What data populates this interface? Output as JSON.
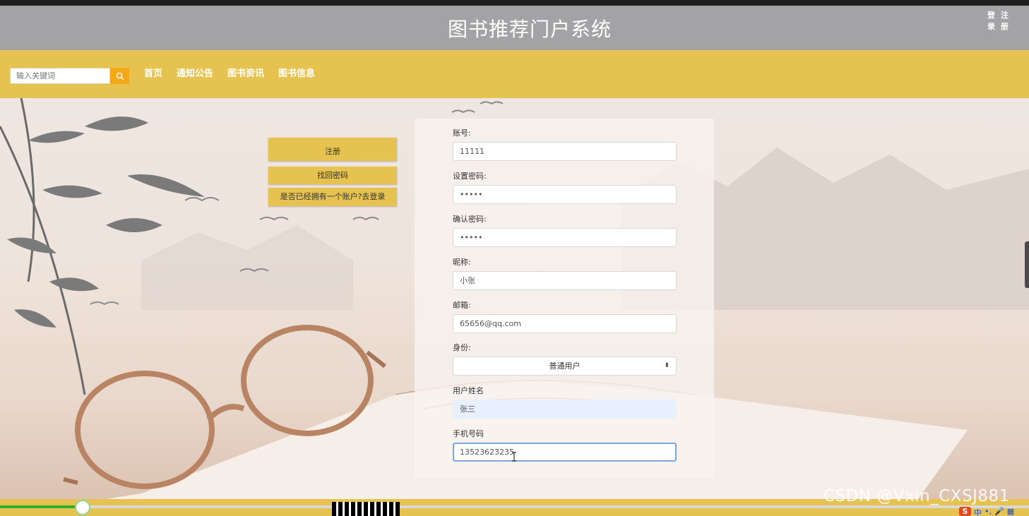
{
  "header": {
    "site_title": "图书推荐门户系统",
    "auth": {
      "login_chars": [
        "登",
        "录"
      ],
      "register_chars": [
        "注",
        "册"
      ]
    }
  },
  "search": {
    "placeholder": "输入关键词"
  },
  "nav": {
    "items": [
      "首页",
      "通知公告",
      "图书资讯",
      "图书信息"
    ]
  },
  "side_buttons": {
    "register": "注册",
    "recover": "找回密码",
    "login_link": "是否已经拥有一个账户?去登录"
  },
  "form": {
    "account": {
      "label": "账号:",
      "value": "11111"
    },
    "password": {
      "label": "设置密码:",
      "value": "•••••"
    },
    "confirm": {
      "label": "确认密码:",
      "value": "•••••"
    },
    "nickname": {
      "label": "昵称:",
      "value": "小张"
    },
    "email": {
      "label": "邮箱:",
      "value": "65656@qq.com"
    },
    "role": {
      "label": "身份:",
      "value": "普通用户"
    },
    "realname": {
      "label": "用户姓名",
      "value": "张三"
    },
    "phone": {
      "label": "手机号码",
      "value": "13523623235"
    }
  },
  "video": {
    "progress": 0.08
  },
  "watermark": "CSDN @Vxin_CXSJ881",
  "ime": {
    "items": [
      "S",
      "中",
      "•,",
      "🎤",
      "▦"
    ]
  },
  "colors": {
    "header": "#a3a3a5",
    "navbar": "#e6c350",
    "search_button": "#f3a917"
  }
}
